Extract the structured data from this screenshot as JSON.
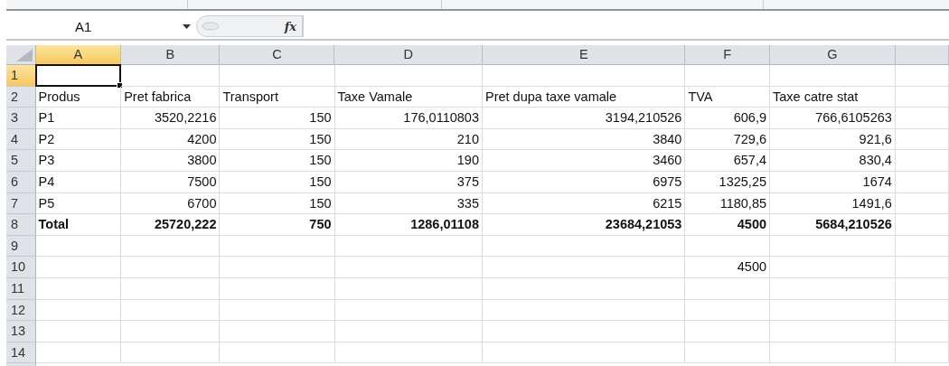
{
  "name_box": "A1",
  "formula_icon": "fx",
  "columns": [
    {
      "label": "A",
      "selected": true
    },
    {
      "label": "B",
      "selected": false
    },
    {
      "label": "C",
      "selected": false
    },
    {
      "label": "D",
      "selected": false
    },
    {
      "label": "E",
      "selected": false
    },
    {
      "label": "F",
      "selected": false
    },
    {
      "label": "G",
      "selected": false
    }
  ],
  "rows": [
    {
      "label": "1",
      "selected": true,
      "kind": "empty"
    },
    {
      "label": "2",
      "selected": false,
      "kind": "labels",
      "bold": false,
      "cells": [
        {
          "text": "Produs"
        },
        {
          "text": "Pret fabrica"
        },
        {
          "text": "Transport"
        },
        {
          "text": "Taxe Vamale"
        },
        {
          "text": "Pret dupa taxe vamale"
        },
        {
          "text": "TVA"
        },
        {
          "text": "Taxe catre stat"
        }
      ]
    },
    {
      "label": "3",
      "selected": false,
      "kind": "values",
      "bold": false,
      "cells": [
        {
          "text": "P1"
        },
        {
          "text": "3520,2216"
        },
        {
          "text": "150"
        },
        {
          "text": "176,0110803"
        },
        {
          "text": "3194,210526"
        },
        {
          "text": "606,9"
        },
        {
          "text": "766,6105263"
        }
      ]
    },
    {
      "label": "4",
      "selected": false,
      "kind": "values",
      "bold": false,
      "cells": [
        {
          "text": "P2"
        },
        {
          "text": "4200"
        },
        {
          "text": "150"
        },
        {
          "text": "210"
        },
        {
          "text": "3840"
        },
        {
          "text": "729,6"
        },
        {
          "text": "921,6"
        }
      ]
    },
    {
      "label": "5",
      "selected": false,
      "kind": "values",
      "bold": false,
      "cells": [
        {
          "text": "P3"
        },
        {
          "text": "3800"
        },
        {
          "text": "150"
        },
        {
          "text": "190"
        },
        {
          "text": "3460"
        },
        {
          "text": "657,4"
        },
        {
          "text": "830,4"
        }
      ]
    },
    {
      "label": "6",
      "selected": false,
      "kind": "values",
      "bold": false,
      "cells": [
        {
          "text": "P4"
        },
        {
          "text": "7500"
        },
        {
          "text": "150"
        },
        {
          "text": "375"
        },
        {
          "text": "6975"
        },
        {
          "text": "1325,25"
        },
        {
          "text": "1674"
        }
      ]
    },
    {
      "label": "7",
      "selected": false,
      "kind": "values",
      "bold": false,
      "cells": [
        {
          "text": "P5"
        },
        {
          "text": "6700"
        },
        {
          "text": "150"
        },
        {
          "text": "335"
        },
        {
          "text": "6215"
        },
        {
          "text": "1180,85"
        },
        {
          "text": "1491,6"
        }
      ]
    },
    {
      "label": "8",
      "selected": false,
      "kind": "values",
      "bold": true,
      "cells": [
        {
          "text": "Total"
        },
        {
          "text": "25720,222"
        },
        {
          "text": "750"
        },
        {
          "text": "1286,01108"
        },
        {
          "text": "23684,21053"
        },
        {
          "text": "4500"
        },
        {
          "text": "5684,210526"
        }
      ]
    },
    {
      "label": "9",
      "selected": false,
      "kind": "empty"
    },
    {
      "label": "10",
      "selected": false,
      "kind": "values",
      "bold": false,
      "cells": [
        {},
        {},
        {},
        {},
        {},
        {
          "text": "4500"
        },
        {}
      ]
    },
    {
      "label": "11",
      "selected": false,
      "kind": "empty"
    },
    {
      "label": "12",
      "selected": false,
      "kind": "empty"
    },
    {
      "label": "13",
      "selected": false,
      "kind": "empty"
    },
    {
      "label": "14",
      "selected": false,
      "kind": "empty"
    }
  ]
}
